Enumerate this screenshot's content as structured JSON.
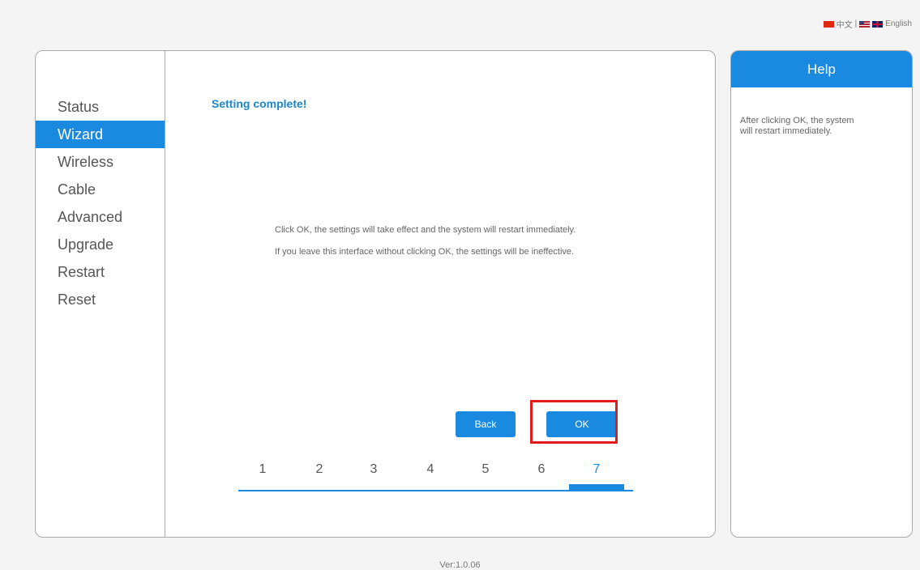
{
  "language": {
    "chinese": "中文",
    "separator": "|",
    "english": "English"
  },
  "sidebar": {
    "items": [
      {
        "label": "Status"
      },
      {
        "label": "Wizard"
      },
      {
        "label": "Wireless"
      },
      {
        "label": "Cable"
      },
      {
        "label": "Advanced"
      },
      {
        "label": "Upgrade"
      },
      {
        "label": "Restart"
      },
      {
        "label": "Reset"
      }
    ],
    "active": "Wizard"
  },
  "main": {
    "title": "Setting complete!",
    "message1": "Click OK, the settings will take effect and the system will restart immediately.",
    "message2": "If you leave this interface without clicking OK, the settings will be ineffective.",
    "back_label": "Back",
    "ok_label": "OK",
    "steps": [
      "1",
      "2",
      "3",
      "4",
      "5",
      "6",
      "7"
    ],
    "current_step": "7"
  },
  "help": {
    "title": "Help",
    "text": "After clicking OK, the system will restart immediately."
  },
  "footer": {
    "version": "Ver:1.0.06"
  },
  "colors": {
    "accent": "#1a8ae0",
    "title": "#1e86c8",
    "highlight": "#e21b1b"
  }
}
